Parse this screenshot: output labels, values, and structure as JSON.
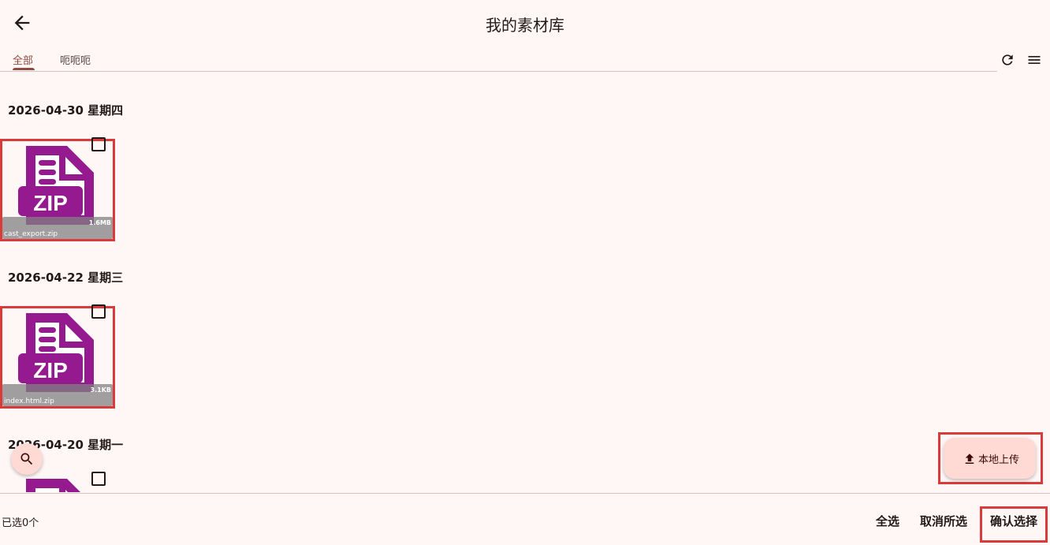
{
  "header": {
    "title": "我的素材库",
    "back_icon": "arrow-left-icon"
  },
  "tabs": [
    {
      "label": "全部",
      "active": true
    },
    {
      "label": "呃呃呃",
      "active": false
    }
  ],
  "toolbar": {
    "refresh_icon": "refresh-icon",
    "menu_icon": "menu-icon"
  },
  "groups": [
    {
      "date": "2026-04-30 星期四",
      "items": [
        {
          "name": "cast_export.zip",
          "size": "1.6MB",
          "type": "ZIP",
          "selected": false
        }
      ]
    },
    {
      "date": "2026-04-22 星期三",
      "items": [
        {
          "name": "index.html.zip",
          "size": "3.1KB",
          "type": "ZIP",
          "selected": false
        }
      ]
    },
    {
      "date": "2026-04-20 星期一",
      "items": [
        {
          "name": "",
          "size": "",
          "type": "ZIP",
          "selected": false
        }
      ]
    }
  ],
  "fab": {
    "search_icon": "search-icon",
    "upload_label": "本地上传",
    "upload_icon": "upload-icon"
  },
  "footer": {
    "selected_count": "已选0个",
    "select_all": "全选",
    "deselect_all": "取消所选",
    "confirm": "确认选择"
  },
  "colors": {
    "background": "#fff7f5",
    "accent": "#904a43",
    "zip_purple": "#951a8f",
    "fab_bg": "#ffdad5",
    "highlight_border": "#d93b3b"
  }
}
